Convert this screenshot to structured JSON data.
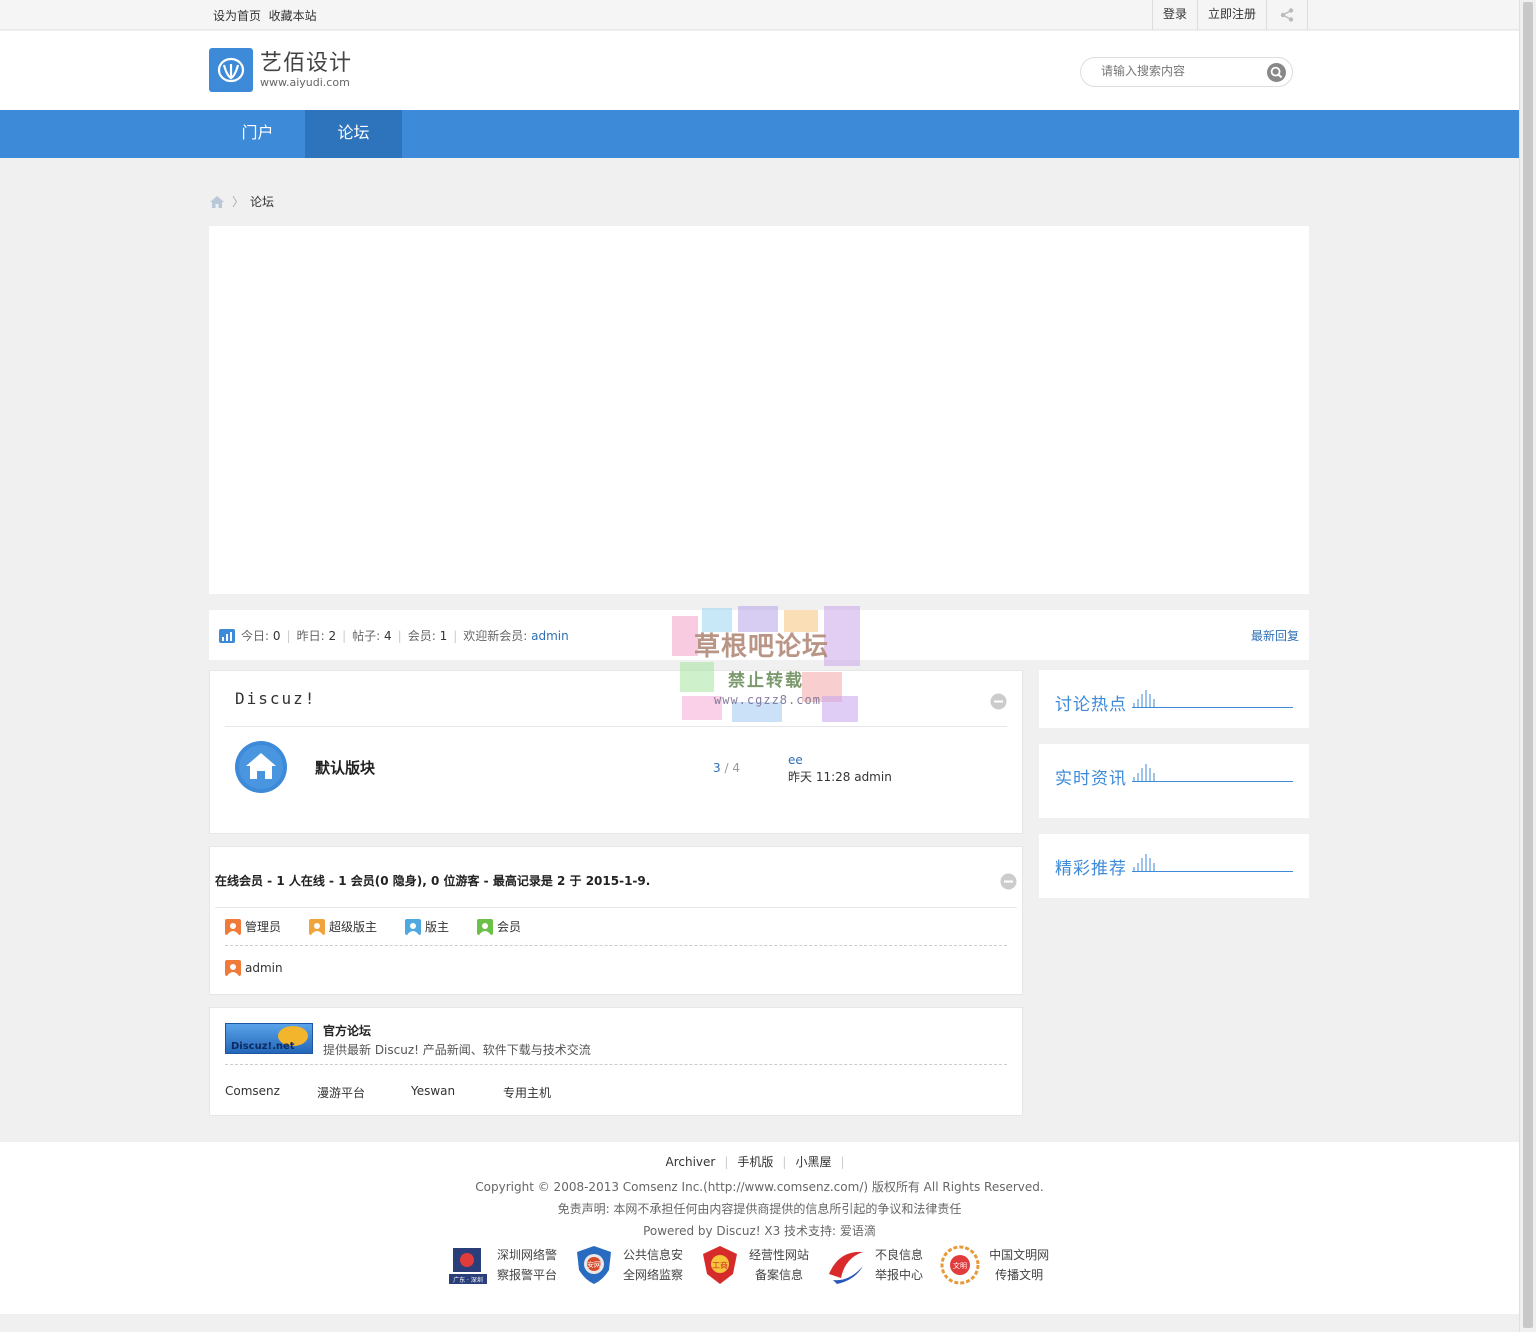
{
  "topbar": {
    "set_home": "设为首页",
    "bookmark": "收藏本站",
    "login": "登录",
    "register": "立即注册"
  },
  "header": {
    "logo_name": "艺佰设计",
    "logo_url": "www.aiyudi.com",
    "search_placeholder": "请输入搜索内容"
  },
  "nav": {
    "items": [
      {
        "label": "门户",
        "active": false
      },
      {
        "label": "论坛",
        "active": true
      }
    ]
  },
  "breadcrumb": {
    "sep": "〉",
    "current": "论坛"
  },
  "stats": {
    "today_label": "今日:",
    "today": "0",
    "yesterday_label": "昨日:",
    "yesterday": "2",
    "posts_label": "帖子:",
    "posts": "4",
    "members_label": "会员:",
    "members": "1",
    "welcome_label": "欢迎新会员:",
    "new_member": "admin",
    "latest_reply": "最新回复"
  },
  "forum": {
    "category": "Discuz!",
    "name": "默认版块",
    "threads": "3",
    "slash": " / ",
    "posts": "4",
    "last_thread": "ee",
    "last_meta": "昨天 11:28 admin"
  },
  "online": {
    "header": "在线会员 - 1 人在线 - 1 会员(0 隐身), 0 位游客 - 最高记录是 2 于 2015-1-9.",
    "legend": [
      "管理员",
      "超级版主",
      "版主",
      "会员"
    ],
    "legend_colors": [
      "#f07a3a",
      "#f2a43c",
      "#4fa8e0",
      "#6cc04a"
    ],
    "members": [
      "admin"
    ]
  },
  "links": {
    "logo_text": "Discuz!.net",
    "title": "官方论坛",
    "desc": "提供最新 Discuz! 产品新闻、软件下载与技术交流",
    "items": [
      "Comsenz",
      "漫游平台",
      "Yeswan",
      "专用主机"
    ]
  },
  "sidebar": {
    "titles": [
      "讨论热点",
      "实时资讯",
      "精彩推荐"
    ]
  },
  "watermark": {
    "title": "草根吧论坛",
    "sub": "禁止转载",
    "url": "www.cgzz8.com"
  },
  "footer": {
    "links": [
      "Archiver",
      "手机版",
      "小黑屋"
    ],
    "copyright": "Copyright © 2008-2013 Comsenz Inc.(http://www.comsenz.com/) 版权所有  All Rights Reserved.",
    "disclaimer": "免责声明: 本网不承担任何由内容提供商提供的信息所引起的争议和法律责任",
    "powered": "Powered by Discuz! X3  技术支持: 爱语滴",
    "badges": [
      {
        "l1": "深圳网络警",
        "l2": "察报警平台",
        "badge_text": "广东 · 深圳"
      },
      {
        "l1": "公共信息安",
        "l2": "全网络监察",
        "badge_text": "安网"
      },
      {
        "l1": "经营性网站",
        "l2": "备案信息",
        "badge_text": "工商"
      },
      {
        "l1": "不良信息",
        "l2": "举报中心",
        "badge_text": ""
      },
      {
        "l1": "中国文明网",
        "l2": "传播文明",
        "badge_text": "文明"
      }
    ]
  },
  "colors": {
    "brand": "#3d8ad8",
    "nav_active": "#2e74bc",
    "link": "#2e6fb5"
  }
}
